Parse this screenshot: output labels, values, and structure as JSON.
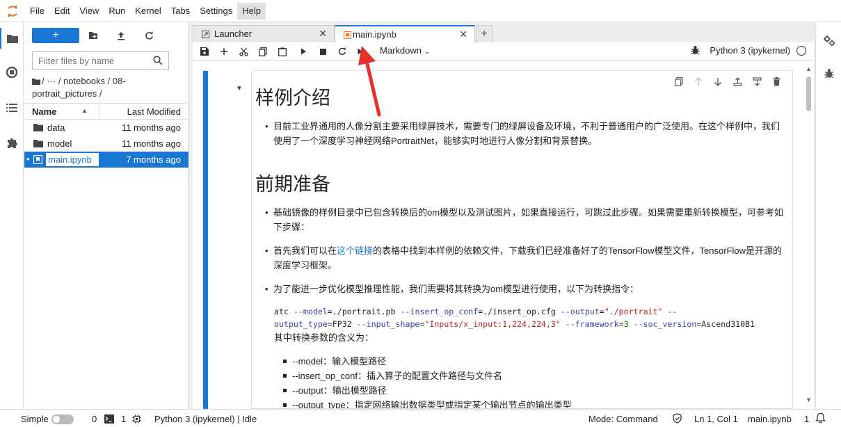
{
  "menu": {
    "items": [
      "File",
      "Edit",
      "View",
      "Run",
      "Kernel",
      "Tabs",
      "Settings",
      "Help"
    ],
    "active_index": 7
  },
  "filebrowser": {
    "new_label": "+",
    "search_placeholder": "Filter files by name",
    "breadcrumb": "/ ··· / notebooks / 08-portrait_pictures /",
    "col_name": "Name",
    "col_modified": "Last Modified",
    "files": [
      {
        "name": "data",
        "modified": "11 months ago",
        "type": "folder"
      },
      {
        "name": "model",
        "modified": "11 months ago",
        "type": "folder"
      },
      {
        "name": "main.ipynb",
        "modified": "7 months ago",
        "type": "notebook",
        "selected": true
      }
    ]
  },
  "tabs": [
    {
      "label": "Launcher",
      "icon": "launcher-icon"
    },
    {
      "label": "main.ipynb",
      "icon": "notebook-icon",
      "active": true
    }
  ],
  "toolbar": {
    "cell_type": "Markdown",
    "kernel_name": "Python 3 (ipykernel)"
  },
  "notebook": {
    "h1_intro": "样例介绍",
    "intro_bullet": "目前工业界通用的人像分割主要采用绿屏技术，需要专门的绿屏设备及环境，不利于普通用户的广泛使用。在这个样例中，我们使用了一个深度学习神经网络PortraitNet，能够实时地进行人像分割和背景替换。",
    "h1_prep": "前期准备",
    "prep_bullet_1": "基础镜像的样例目录中已包含转换后的om模型以及测试图片，如果直接运行，可跳过此步骤。如果需要重新转换模型，可参考如下步骤：",
    "prep_bullet_2_pre": "首先我们可以在",
    "prep_bullet_2_link": "这个链接",
    "prep_bullet_2_post": "的表格中找到本样例的依赖文件，下载我们已经准备好了的TensorFlow模型文件，TensorFlow是开源的深度学习框架。",
    "prep_bullet_3": "为了能进一步优化模型推理性能，我们需要将其转换为om模型进行使用，以下为转换指令：",
    "code_line_1": {
      "cmd": "atc ",
      "p1": "--model",
      "v1": "=./portrait.pb  ",
      "p2": "--insert_op_conf",
      "v2": "=./insert_op.cfg  ",
      "p3": "--output",
      "v3a": "=",
      "v3": "\"./portrait\"",
      "p4": " --"
    },
    "code_line_2": {
      "p4": "output_type",
      "v4": "=FP32 ",
      "p5": "--input_shape",
      "v5a": "=",
      "v5": "\"Inputs/x_input:1,224,224,3\"",
      "p6": " --framework",
      "v6a": "=",
      "v6": "3",
      "p7": " --soc_version",
      "v7": "=Ascend310B1"
    },
    "param_intro": "其中转换参数的含义为：",
    "params": [
      "--model：输入模型路径",
      "--insert_op_conf：插入算子的配置文件路径与文件名",
      "--output：输出模型路径",
      "--output_type：指定网络输出数据类型或指定某个输出节点的输出类型"
    ]
  },
  "statusbar": {
    "mode_label": "Simple",
    "terminals": "0",
    "kernels": "1",
    "kernel_status": "Python 3 (ipykernel) | Idle",
    "command_mode": "Mode: Command",
    "cursor": "Ln 1, Col 1",
    "filename": "main.ipynb",
    "notifications": "1"
  }
}
